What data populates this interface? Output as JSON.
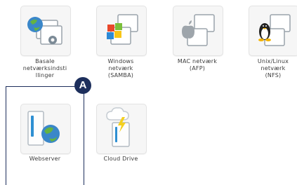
{
  "apps": [
    {
      "lines": [
        "Basale",
        "netværksindsti",
        "llinger"
      ],
      "icon": "basic-network-settings-icon"
    },
    {
      "lines": [
        "Windows",
        "netværk",
        "(SAMBA)"
      ],
      "icon": "windows-network-icon"
    },
    {
      "lines": [
        "MAC netværk",
        "(AFP)"
      ],
      "icon": "mac-network-icon"
    },
    {
      "lines": [
        "Unix/Linux",
        "netværk",
        "(NFS)"
      ],
      "icon": "linux-network-icon"
    },
    {
      "lines": [
        "Webserver"
      ],
      "icon": "webserver-icon"
    },
    {
      "lines": [
        "Cloud Drive"
      ],
      "icon": "cloud-drive-icon"
    }
  ],
  "callout": {
    "label": "A",
    "color": "#1d2f5c"
  }
}
